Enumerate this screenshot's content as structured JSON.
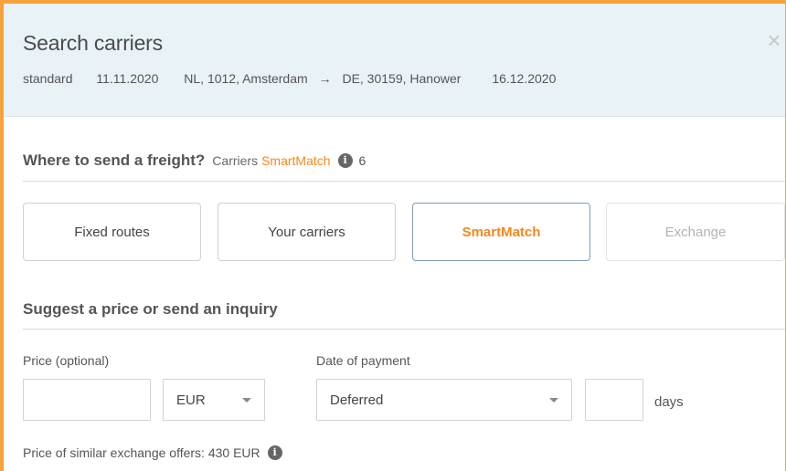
{
  "header": {
    "title": "Search carriers",
    "close_icon": "×",
    "route": {
      "type": "standard",
      "pickup_date": "11.11.2020",
      "origin": "NL, 1012, Amsterdam",
      "arrow": "→",
      "destination": "DE, 30159, Hanower",
      "delivery_date": "16.12.2020"
    }
  },
  "freight": {
    "heading": "Where to send a freight?",
    "carriers_label": "Carriers",
    "smartmatch_label": "SmartMatch",
    "info_icon": "i",
    "count": "6"
  },
  "tabs": [
    {
      "label": "Fixed routes",
      "state": "normal"
    },
    {
      "label": "Your carriers",
      "state": "normal"
    },
    {
      "label": "SmartMatch",
      "state": "active"
    },
    {
      "label": "Exchange",
      "state": "disabled"
    }
  ],
  "inquiry": {
    "heading": "Suggest a price or send an inquiry",
    "price_label": "Price (optional)",
    "price_value": "",
    "currency_value": "EUR",
    "payment_label": "Date of payment",
    "payment_value": "Deferred",
    "days_value": "",
    "days_label": "days",
    "similar_offers": "Price of similar exchange offers: 430 EUR",
    "info_icon": "i"
  },
  "colors": {
    "accent": "#f7861c",
    "frame_border": "#f7a23c",
    "header_bg": "#e9f2f7",
    "active_tab_border": "#7f9cb5"
  }
}
